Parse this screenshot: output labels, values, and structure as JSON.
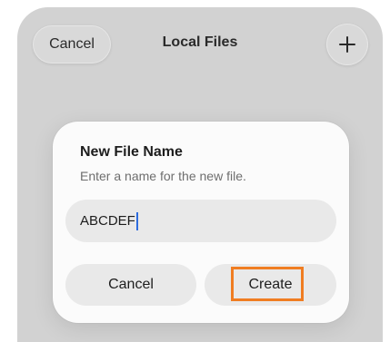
{
  "navbar": {
    "cancel_label": "Cancel",
    "title": "Local Files",
    "add_icon": "plus-icon"
  },
  "dialog": {
    "title": "New File Name",
    "message": "Enter a name for the new file.",
    "input_value": "ABCDEF",
    "cancel_label": "Cancel",
    "create_label": "Create"
  },
  "colors": {
    "highlight": "#f07d22",
    "caret": "#2d6cdf",
    "dim_background": "#d2d2d2"
  }
}
